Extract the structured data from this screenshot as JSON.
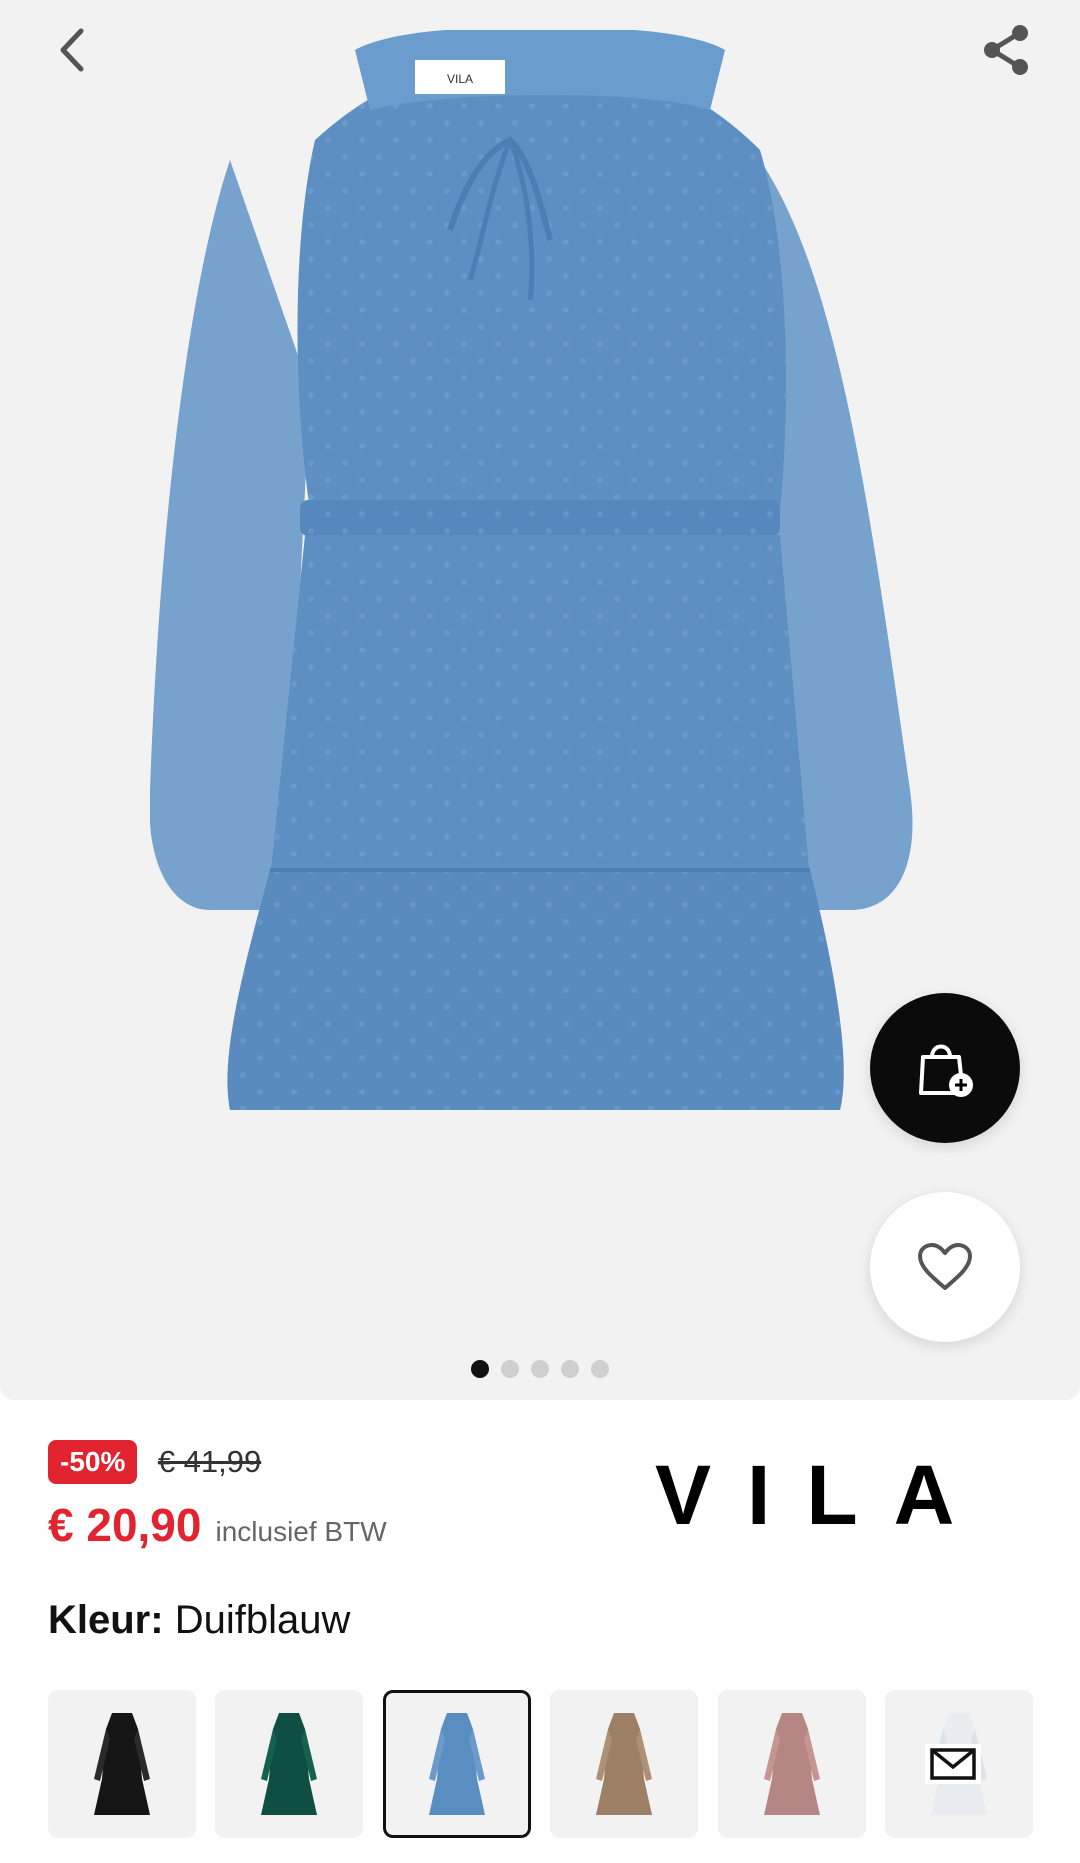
{
  "product": {
    "discount_badge": "-50%",
    "old_price": "€ 41,99",
    "price": "€ 20,90",
    "vat_note": "inclusief BTW",
    "brand": "VILA",
    "color_label": "Kleur:",
    "color_value": "Duifblauw",
    "dress_label": "VILA"
  },
  "gallery": {
    "dots": 5,
    "active_dot": 1
  },
  "swatches": [
    {
      "name": "black",
      "color": "#151515"
    },
    {
      "name": "green",
      "color": "#0f4f43"
    },
    {
      "name": "blue",
      "color": "#5b8ec0",
      "selected": true
    },
    {
      "name": "beige",
      "color": "#9c7f64"
    },
    {
      "name": "rose",
      "color": "#b58683"
    },
    {
      "name": "white",
      "color": "#e9edf2"
    }
  ],
  "colors": {
    "sale_red": "#e1242f",
    "dress_blue": "#5e8fc2",
    "background": "#f2f2f2"
  },
  "icons": {
    "back": "chevron-left-icon",
    "share": "share-icon",
    "add_to_bag": "bag-plus-icon",
    "wishlist": "heart-icon",
    "mail": "mail-icon"
  }
}
